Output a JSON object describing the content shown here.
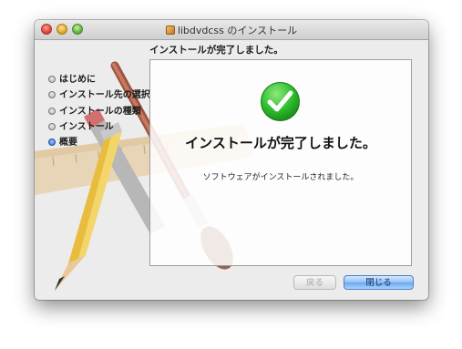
{
  "window": {
    "title": "libdvdcss のインストール",
    "heading": "インストールが完了しました。"
  },
  "sidebar": {
    "steps": [
      {
        "label": "はじめに",
        "state": "done"
      },
      {
        "label": "インストール先の選択",
        "state": "done"
      },
      {
        "label": "インストールの種類",
        "state": "done"
      },
      {
        "label": "インストール",
        "state": "done"
      },
      {
        "label": "概要",
        "state": "current"
      }
    ]
  },
  "content": {
    "icon": "checkmark-icon",
    "main_message": "インストールが完了しました。",
    "sub_message": "ソフトウェアがインストールされました。"
  },
  "buttons": {
    "back_label": "戻る",
    "back_enabled": false,
    "close_label": "閉じる"
  },
  "colors": {
    "accent": "#2c6fd6",
    "success": "#2fbf2f"
  }
}
